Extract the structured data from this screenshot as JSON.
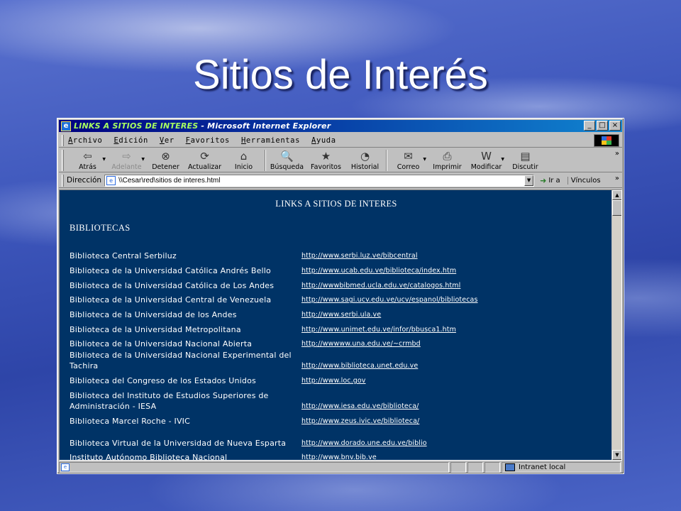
{
  "slide": {
    "title": "Sitios de Interés"
  },
  "window": {
    "title_prefix": "LINKS A SITIOS DE INTERES",
    "title_suffix": " - Microsoft Internet Explorer",
    "controls": {
      "minimize": "_",
      "maximize": "□",
      "close": "×"
    }
  },
  "menu": {
    "items": [
      {
        "first": "A",
        "rest": "rchivo"
      },
      {
        "first": "E",
        "rest": "dición"
      },
      {
        "first": "V",
        "rest": "er"
      },
      {
        "first": "F",
        "rest": "avoritos"
      },
      {
        "first": "H",
        "rest": "erramientas"
      },
      {
        "first": "A",
        "rest": "yuda"
      }
    ]
  },
  "toolbar": {
    "buttons": [
      {
        "label": "Atrás",
        "icon": "back-arrow-icon",
        "glyph": "⇦"
      },
      {
        "label": "Adelante",
        "icon": "forward-arrow-icon",
        "glyph": "⇨"
      },
      {
        "label": "Detener",
        "icon": "stop-icon",
        "glyph": "⊗"
      },
      {
        "label": "Actualizar",
        "icon": "refresh-icon",
        "glyph": "⟳"
      },
      {
        "label": "Inicio",
        "icon": "home-icon",
        "glyph": "⌂"
      },
      {
        "label": "Búsqueda",
        "icon": "search-icon",
        "glyph": "🔍"
      },
      {
        "label": "Favoritos",
        "icon": "favorites-icon",
        "glyph": "★"
      },
      {
        "label": "Historial",
        "icon": "history-icon",
        "glyph": "◔"
      },
      {
        "label": "Correo",
        "icon": "mail-icon",
        "glyph": "✉"
      },
      {
        "label": "Imprimir",
        "icon": "printer-icon",
        "glyph": "⎙"
      },
      {
        "label": "Modificar",
        "icon": "edit-icon",
        "glyph": "W"
      },
      {
        "label": "Discutir",
        "icon": "discuss-icon",
        "glyph": "▤"
      }
    ]
  },
  "address": {
    "label": "Dirección",
    "value": "\\\\Cesar\\red\\sitios de interes.html",
    "go_label": "Ir a",
    "links_label": "Vínculos"
  },
  "page": {
    "heading": "LINKS A SITIOS DE INTERES",
    "section": "BIBLIOTECAS",
    "rows": [
      {
        "name": "Biblioteca Central Serbiluz",
        "url": "http://www.serbi.luz.ve/bibcentral"
      },
      {
        "name": "Biblioteca de la Universidad Católica Andrés Bello",
        "url": "http://www.ucab.edu.ve/biblioteca/index.htm"
      },
      {
        "name": "Biblioteca de la Universidad Católica de Los Andes",
        "url": "http://wwwbibmed.ucla.edu.ve/catalogos.html"
      },
      {
        "name": "Biblioteca de la Universidad Central de Venezuela",
        "url": "http://www.sagi.ucv.edu.ve/ucv/espanol/bibliotecas"
      },
      {
        "name": "Biblioteca de la Universidad de los Andes",
        "url": "http://www.serbi.ula.ve"
      },
      {
        "name": "Biblioteca de la Universidad Metropolitana",
        "url": "http://www.unimet.edu.ve/infor/bbusca1.htm"
      },
      {
        "name": "Biblioteca de la Universidad Nacional Abierta",
        "url": "http://wwwww.una.edu.ve/~crmbd"
      },
      {
        "name": "Biblioteca de la Universidad Nacional Experimental del Tachira",
        "url": "http://www.biblioteca.unet.edu.ve"
      },
      {
        "name": "Biblioteca del Congreso de los Estados Unidos",
        "url": "http://www.loc.gov"
      },
      {
        "name": "Biblioteca del Instituto de Estudios Superiores de Administración - IESA",
        "url": "http://www.iesa.edu.ve/biblioteca/"
      },
      {
        "name": "Biblioteca Marcel Roche - IVIC",
        "url": "http://www.zeus.ivic.ve/biblioteca/"
      },
      {
        "name": "Biblioteca Virtual de la Universidad de Nueva Esparta",
        "url": "http://www.dorado.une.edu.ve/biblio"
      },
      {
        "name": "Instituto Autónomo Biblioteca Nacional",
        "url": "http://www.bnv.bib.ve"
      }
    ]
  },
  "status": {
    "zone": "Intranet local"
  },
  "colors": {
    "page_background": "#003366",
    "titlebar": "#000080",
    "link": "#ffffff"
  }
}
